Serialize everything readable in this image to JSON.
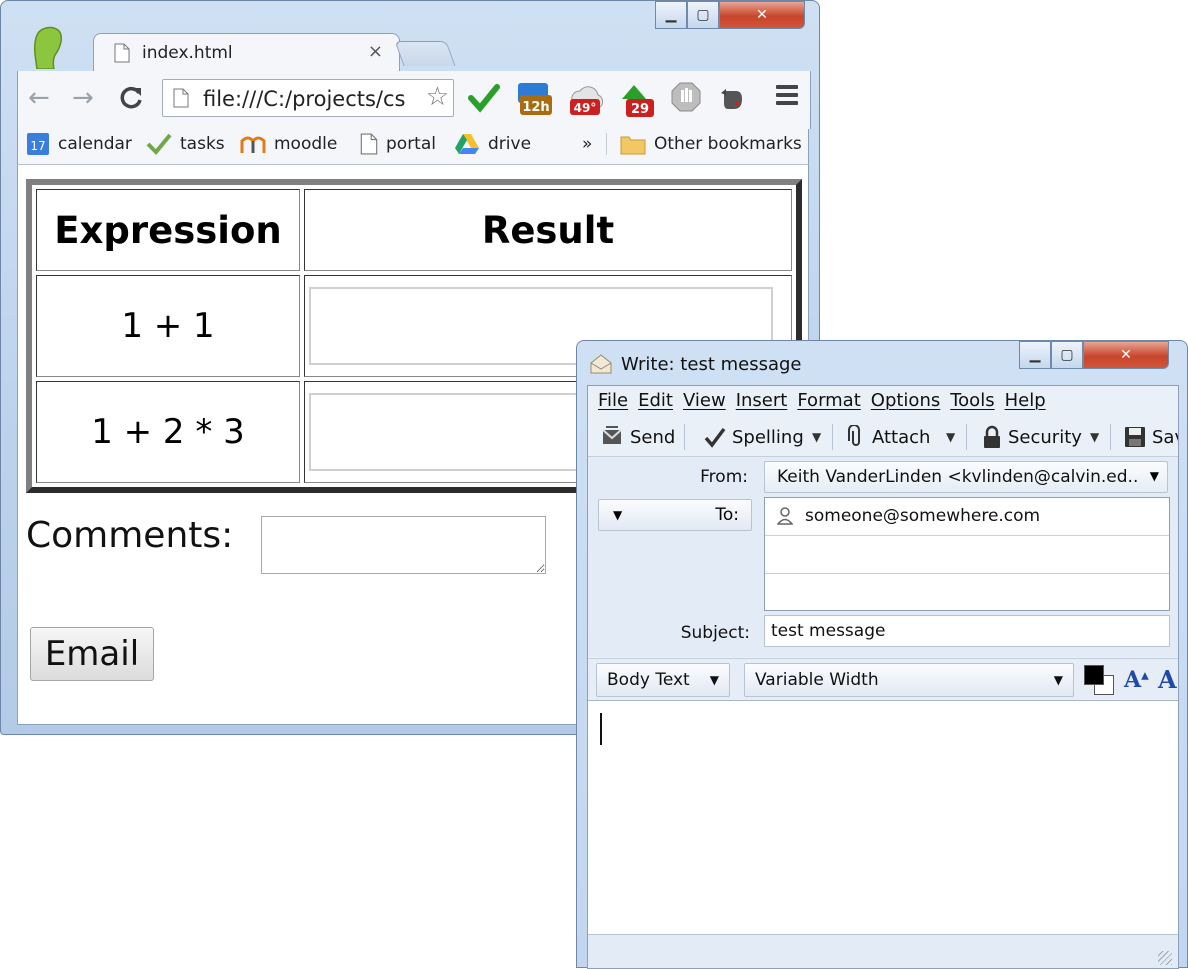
{
  "browser": {
    "tab_title": "index.html",
    "tab_close": "×",
    "address": "file:///C:/projects/cs",
    "bookmarks": [
      {
        "label": "calendar",
        "icon": "google-calendar-icon"
      },
      {
        "label": "tasks",
        "icon": "checkmark-icon"
      },
      {
        "label": "moodle",
        "icon": "moodle-icon"
      },
      {
        "label": "portal",
        "icon": "page-icon"
      },
      {
        "label": "drive",
        "icon": "google-drive-icon"
      }
    ],
    "calendar_day": "17",
    "overflow": "»",
    "other_bookmarks": "Other bookmarks",
    "extensions": [
      {
        "icon": "green-check-extension-icon"
      },
      {
        "icon": "calendar-12h-extension-icon",
        "badge": "12h"
      },
      {
        "icon": "weather-extension-icon",
        "badge": "49°"
      },
      {
        "icon": "notifications-extension-icon",
        "badge": "29"
      },
      {
        "icon": "stop-hand-extension-icon"
      },
      {
        "icon": "evernote-extension-icon"
      }
    ]
  },
  "page": {
    "table_headers": [
      "Expression",
      "Result"
    ],
    "rows": [
      {
        "expression": "1 + 1",
        "result": ""
      },
      {
        "expression": "1 + 2 * 3",
        "result": ""
      }
    ],
    "comments_label": "Comments:",
    "comments_value": "",
    "email_button": "Email"
  },
  "compose": {
    "title": "Write: test message",
    "menu": [
      "File",
      "Edit",
      "View",
      "Insert",
      "Format",
      "Options",
      "Tools",
      "Help"
    ],
    "toolbar": {
      "send": "Send",
      "spelling": "Spelling",
      "attach": "Attach",
      "security": "Security",
      "save": "Sav"
    },
    "from_label": "From:",
    "from_value": "Keith VanderLinden <kvlinden@calvin.ed...",
    "to_label": "To:",
    "recipients": [
      "someone@somewhere.com",
      "",
      ""
    ],
    "subject_label": "Subject:",
    "subject_value": "test message",
    "format": {
      "paragraph": "Body Text",
      "font": "Variable Width",
      "text_color": "#000000",
      "bg_color": "#ffffff"
    }
  }
}
